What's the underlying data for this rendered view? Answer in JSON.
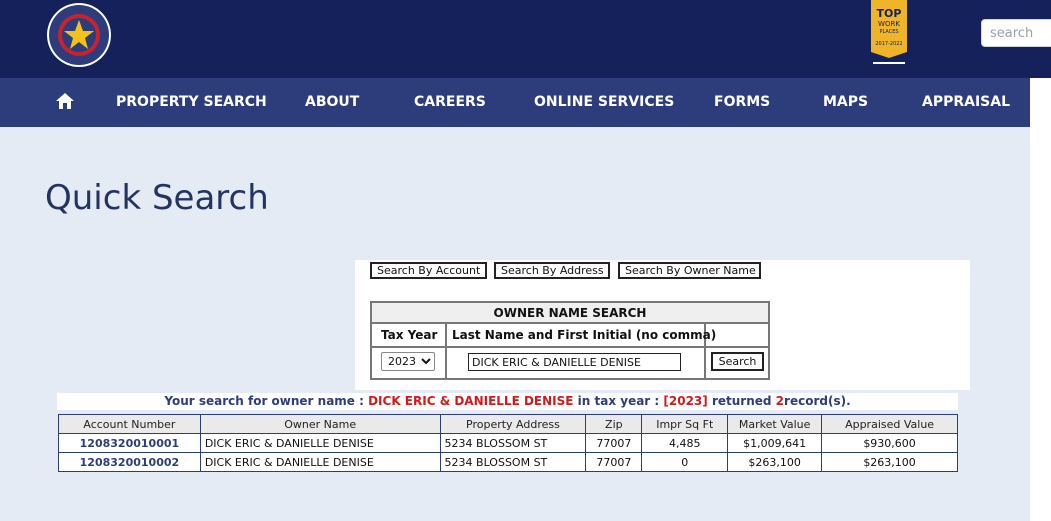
{
  "header": {
    "search_placeholder": "search",
    "seal_text": "HARRIS CENTRAL APPRAISAL DISTRICT",
    "seal_state": "Texas",
    "award": {
      "line1": "TOP",
      "line2": "WORK",
      "line3": "PLACES",
      "years": "2017-2022"
    }
  },
  "nav": {
    "items": [
      {
        "label": "PROPERTY SEARCH"
      },
      {
        "label": "ABOUT"
      },
      {
        "label": "CAREERS"
      },
      {
        "label": "ONLINE SERVICES"
      },
      {
        "label": "FORMS"
      },
      {
        "label": "MAPS"
      },
      {
        "label": "APPRAISAL"
      }
    ]
  },
  "page": {
    "title": "Quick Search"
  },
  "search_tabs": [
    "Search By Account",
    "Search By Address",
    "Search By Owner Name"
  ],
  "owner_form": {
    "title": "OWNER NAME SEARCH",
    "tax_year_label": "Tax Year",
    "name_label": "Last Name and First Initial (no comma)",
    "tax_year_value": "2023",
    "name_value": "DICK ERIC & DANIELLE DENISE",
    "search_button": "Search"
  },
  "summary": {
    "prefix": "Your search for owner name :",
    "owner": "DICK ERIC & DANIELLE DENISE",
    "mid": "in tax year :",
    "year": "[2023]",
    "returned": "returned",
    "count": "2",
    "suffix": "record(s)."
  },
  "results": {
    "columns": [
      "Account Number",
      "Owner Name",
      "Property Address",
      "Zip",
      "Impr Sq Ft",
      "Market Value",
      "Appraised Value"
    ],
    "rows": [
      [
        "1208320010001",
        "DICK ERIC & DANIELLE DENISE",
        "5234 BLOSSOM ST",
        "77007",
        "4,485",
        "$1,009,641",
        "$930,600"
      ],
      [
        "1208320010002",
        "DICK ERIC & DANIELLE DENISE",
        "5234 BLOSSOM ST",
        "77007",
        "0",
        "$263,100",
        "$263,100"
      ]
    ]
  },
  "colors": {
    "header_bg": "#14215a",
    "nav_bg": "#2d3d7c",
    "page_bg": "#e4ebf5",
    "highlight_red": "#d31a1a"
  }
}
